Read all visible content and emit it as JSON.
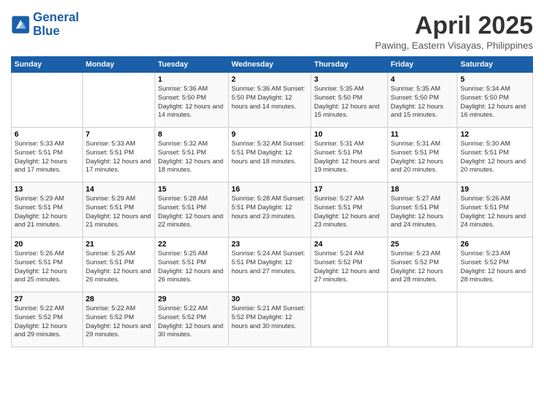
{
  "logo": {
    "line1": "General",
    "line2": "Blue"
  },
  "title": "April 2025",
  "subtitle": "Pawing, Eastern Visayas, Philippines",
  "days_of_week": [
    "Sunday",
    "Monday",
    "Tuesday",
    "Wednesday",
    "Thursday",
    "Friday",
    "Saturday"
  ],
  "weeks": [
    [
      {
        "day": "",
        "info": ""
      },
      {
        "day": "",
        "info": ""
      },
      {
        "day": "1",
        "info": "Sunrise: 5:36 AM\nSunset: 5:50 PM\nDaylight: 12 hours and 14 minutes."
      },
      {
        "day": "2",
        "info": "Sunrise: 5:36 AM\nSunset: 5:50 PM\nDaylight: 12 hours and 14 minutes."
      },
      {
        "day": "3",
        "info": "Sunrise: 5:35 AM\nSunset: 5:50 PM\nDaylight: 12 hours and 15 minutes."
      },
      {
        "day": "4",
        "info": "Sunrise: 5:35 AM\nSunset: 5:50 PM\nDaylight: 12 hours and 15 minutes."
      },
      {
        "day": "5",
        "info": "Sunrise: 5:34 AM\nSunset: 5:50 PM\nDaylight: 12 hours and 16 minutes."
      }
    ],
    [
      {
        "day": "6",
        "info": "Sunrise: 5:33 AM\nSunset: 5:51 PM\nDaylight: 12 hours and 17 minutes."
      },
      {
        "day": "7",
        "info": "Sunrise: 5:33 AM\nSunset: 5:51 PM\nDaylight: 12 hours and 17 minutes."
      },
      {
        "day": "8",
        "info": "Sunrise: 5:32 AM\nSunset: 5:51 PM\nDaylight: 12 hours and 18 minutes."
      },
      {
        "day": "9",
        "info": "Sunrise: 5:32 AM\nSunset: 5:51 PM\nDaylight: 12 hours and 18 minutes."
      },
      {
        "day": "10",
        "info": "Sunrise: 5:31 AM\nSunset: 5:51 PM\nDaylight: 12 hours and 19 minutes."
      },
      {
        "day": "11",
        "info": "Sunrise: 5:31 AM\nSunset: 5:51 PM\nDaylight: 12 hours and 20 minutes."
      },
      {
        "day": "12",
        "info": "Sunrise: 5:30 AM\nSunset: 5:51 PM\nDaylight: 12 hours and 20 minutes."
      }
    ],
    [
      {
        "day": "13",
        "info": "Sunrise: 5:29 AM\nSunset: 5:51 PM\nDaylight: 12 hours and 21 minutes."
      },
      {
        "day": "14",
        "info": "Sunrise: 5:29 AM\nSunset: 5:51 PM\nDaylight: 12 hours and 21 minutes."
      },
      {
        "day": "15",
        "info": "Sunrise: 5:28 AM\nSunset: 5:51 PM\nDaylight: 12 hours and 22 minutes."
      },
      {
        "day": "16",
        "info": "Sunrise: 5:28 AM\nSunset: 5:51 PM\nDaylight: 12 hours and 23 minutes."
      },
      {
        "day": "17",
        "info": "Sunrise: 5:27 AM\nSunset: 5:51 PM\nDaylight: 12 hours and 23 minutes."
      },
      {
        "day": "18",
        "info": "Sunrise: 5:27 AM\nSunset: 5:51 PM\nDaylight: 12 hours and 24 minutes."
      },
      {
        "day": "19",
        "info": "Sunrise: 5:26 AM\nSunset: 5:51 PM\nDaylight: 12 hours and 24 minutes."
      }
    ],
    [
      {
        "day": "20",
        "info": "Sunrise: 5:26 AM\nSunset: 5:51 PM\nDaylight: 12 hours and 25 minutes."
      },
      {
        "day": "21",
        "info": "Sunrise: 5:25 AM\nSunset: 5:51 PM\nDaylight: 12 hours and 26 minutes."
      },
      {
        "day": "22",
        "info": "Sunrise: 5:25 AM\nSunset: 5:51 PM\nDaylight: 12 hours and 26 minutes."
      },
      {
        "day": "23",
        "info": "Sunrise: 5:24 AM\nSunset: 5:51 PM\nDaylight: 12 hours and 27 minutes."
      },
      {
        "day": "24",
        "info": "Sunrise: 5:24 AM\nSunset: 5:52 PM\nDaylight: 12 hours and 27 minutes."
      },
      {
        "day": "25",
        "info": "Sunrise: 5:23 AM\nSunset: 5:52 PM\nDaylight: 12 hours and 28 minutes."
      },
      {
        "day": "26",
        "info": "Sunrise: 5:23 AM\nSunset: 5:52 PM\nDaylight: 12 hours and 28 minutes."
      }
    ],
    [
      {
        "day": "27",
        "info": "Sunrise: 5:22 AM\nSunset: 5:52 PM\nDaylight: 12 hours and 29 minutes."
      },
      {
        "day": "28",
        "info": "Sunrise: 5:22 AM\nSunset: 5:52 PM\nDaylight: 12 hours and 29 minutes."
      },
      {
        "day": "29",
        "info": "Sunrise: 5:22 AM\nSunset: 5:52 PM\nDaylight: 12 hours and 30 minutes."
      },
      {
        "day": "30",
        "info": "Sunrise: 5:21 AM\nSunset: 5:52 PM\nDaylight: 12 hours and 30 minutes."
      },
      {
        "day": "",
        "info": ""
      },
      {
        "day": "",
        "info": ""
      },
      {
        "day": "",
        "info": ""
      }
    ]
  ]
}
